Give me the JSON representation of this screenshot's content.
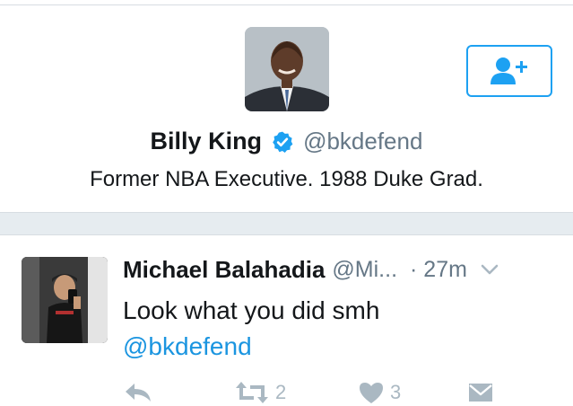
{
  "profile": {
    "display_name": "Billy King",
    "handle": "@bkdefend",
    "bio": "Former NBA Executive. 1988 Duke Grad.",
    "verified": true
  },
  "tweet": {
    "author": "Michael Balahadia",
    "handle": "@Mi...",
    "time": "· 27m",
    "text": "Look what you did smh",
    "mention": "@bkdefend",
    "actions": {
      "retweet_count": "2",
      "like_count": "3"
    }
  },
  "colors": {
    "accent": "#1da1f2",
    "link": "#1b95e0",
    "muted": "#657786",
    "icon": "#aab8c2",
    "divider_band": "#e6ecf0"
  },
  "icons": {
    "follow": "add-user-icon",
    "verified": "verified-badge-icon",
    "caret": "chevron-down-icon",
    "reply": "reply-icon",
    "retweet": "retweet-icon",
    "like": "heart-icon",
    "message": "direct-message-icon"
  }
}
